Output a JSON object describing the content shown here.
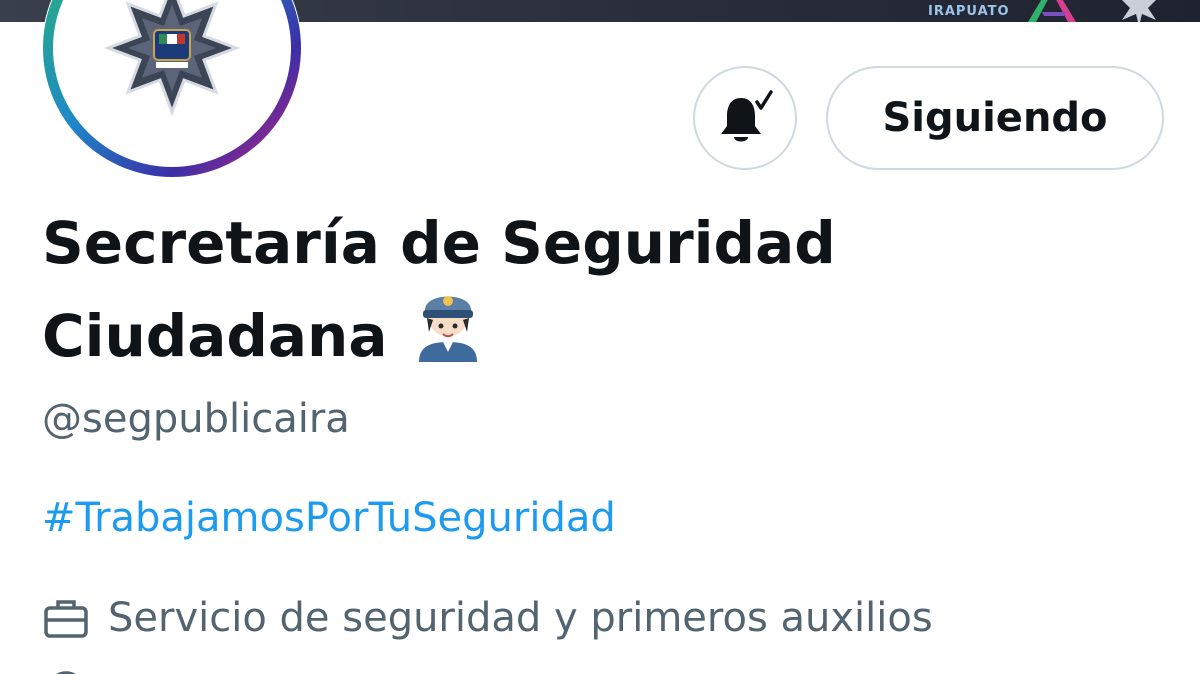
{
  "banner": {
    "logo_text": "IRAPUATO"
  },
  "profile": {
    "display_name_line1": "Secretaría de Seguridad",
    "display_name_line2": "Ciudadana",
    "name_emoji": "police-officer-emoji",
    "handle": "@segpublicaira",
    "bio_hashtag": "#TrabajamosPorTuSeguridad",
    "category": "Servicio de seguridad y primeros auxilios"
  },
  "actions": {
    "notifications_icon": "bell-check-icon",
    "follow_label": "Siguiendo"
  },
  "colors": {
    "text_primary": "#0f1419",
    "text_secondary": "#536471",
    "link": "#1d9bf0",
    "button_border": "#cfd9de"
  }
}
